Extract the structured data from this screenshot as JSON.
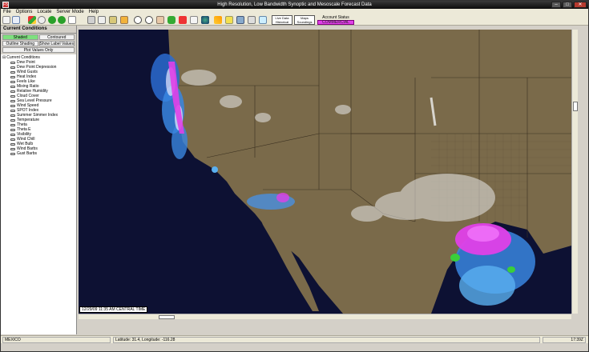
{
  "window": {
    "title": "High Resolution, Low Bandwidth Synoptic and Mesoscale Forecast Data",
    "icon_label": "F5"
  },
  "menu": [
    "File",
    "Options",
    "Locate",
    "Server Mode",
    "Help"
  ],
  "toolbar": {
    "live_data": "Live Data",
    "historical": "Historical",
    "maps": "Maps",
    "soundings": "Soundings",
    "account_status_label": "Account Status",
    "account_status_value": "COMMERCIAL"
  },
  "panel": {
    "header": "Current Conditions",
    "shaded": "Shaded",
    "contoured": "Contoured",
    "outline_shading": "Outline Shading",
    "show_label_values": "Show Label Values",
    "plot_values_only": "Plot Values Only",
    "tree_root": "Current Conditions",
    "items": [
      "Dew Point",
      "Dew Point Depression",
      "Wind Gusts",
      "Heat Index",
      "Feels Like",
      "Mixing Ratio",
      "Relative Humidity",
      "Cloud Cover",
      "Sea Level Pressure",
      "Wind Speed",
      "SPOT Index",
      "Summer Simmer Index",
      "Temperature",
      "Theta",
      "Theta E",
      "Visibility",
      "Wind Chill",
      "Wet Bulb",
      "Wind Barbs",
      "Gust Barbs"
    ]
  },
  "map": {
    "timestamp": "12/29/09 11:35 AM CENTRAL TIME"
  },
  "status": {
    "region": "MEXICO",
    "latlon": "Latitude: 31.4, Longitude: -116.28",
    "time": "17:39Z"
  },
  "colors": {
    "ocean": "#0d1133",
    "land": "#7a6a4a",
    "shaded_active": "#7ee07e",
    "account_badge": "#e040e8"
  }
}
